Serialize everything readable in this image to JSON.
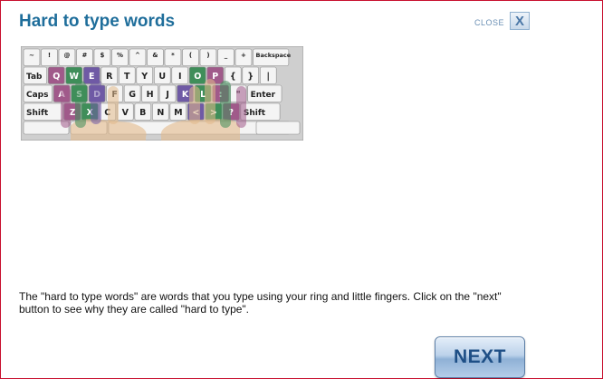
{
  "header": {
    "title": "Hard to type words",
    "close_label": "CLOSE",
    "close_glyph": "X"
  },
  "keyboard": {
    "rows": [
      [
        "~",
        "!",
        "@",
        "#",
        "$",
        "%",
        "^",
        "&",
        "*",
        "(",
        ")",
        "_",
        "+",
        "Backspace"
      ],
      [
        "Tab",
        "Q",
        "W",
        "E",
        "R",
        "T",
        "Y",
        "U",
        "I",
        "O",
        "P",
        "{",
        "}",
        "|"
      ],
      [
        "Caps",
        "A",
        "S",
        "D",
        "F",
        "G",
        "H",
        "J",
        "K",
        "L",
        ":",
        "\"",
        "Enter"
      ],
      [
        "Shift",
        "Z",
        "X",
        "C",
        "V",
        "B",
        "N",
        "M",
        "<",
        ">",
        "?",
        "Shift"
      ]
    ],
    "highlight_colors": {
      "little": "#a05a8a",
      "ring": "#3f8e5a",
      "middle": "#6f5aa5"
    }
  },
  "instructions": {
    "text": "The \"hard to type words\" are words that you type using your ring and little fingers. Click on the \"next\" button to see why they are called \"hard to type\"."
  },
  "next_button": {
    "label": "NEXT"
  }
}
